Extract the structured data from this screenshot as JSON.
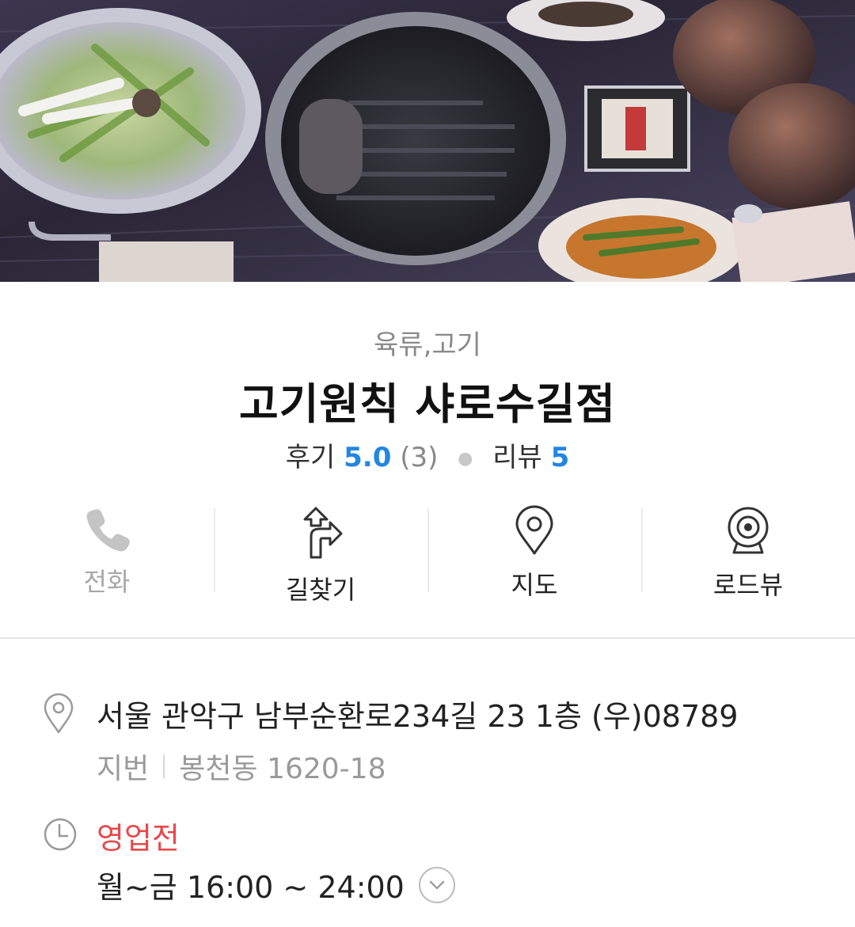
{
  "hero": {
    "image": "grill-table-photo"
  },
  "place": {
    "category": "육류,고기",
    "name": "고기원칙 샤로수길점",
    "review_label": "후기",
    "review_score": "5.0",
    "review_count": "(3)",
    "blog_label": "리뷰",
    "blog_count": "5"
  },
  "actions": [
    {
      "label": "전화",
      "icon": "phone-icon",
      "enabled": false
    },
    {
      "label": "길찾기",
      "icon": "directions-icon",
      "enabled": true
    },
    {
      "label": "지도",
      "icon": "map-pin-icon",
      "enabled": true
    },
    {
      "label": "로드뷰",
      "icon": "roadview-icon",
      "enabled": true
    }
  ],
  "info": {
    "address": "서울 관악구 남부순환로234길 23 1층 (우)08789",
    "jibun_label": "지번",
    "jibun_value": "봉천동 1620-18",
    "status": "영업전",
    "hours": "월~금 16:00 ~ 24:00"
  },
  "colors": {
    "accent": "#2386e0",
    "status_red": "#e8484b"
  }
}
